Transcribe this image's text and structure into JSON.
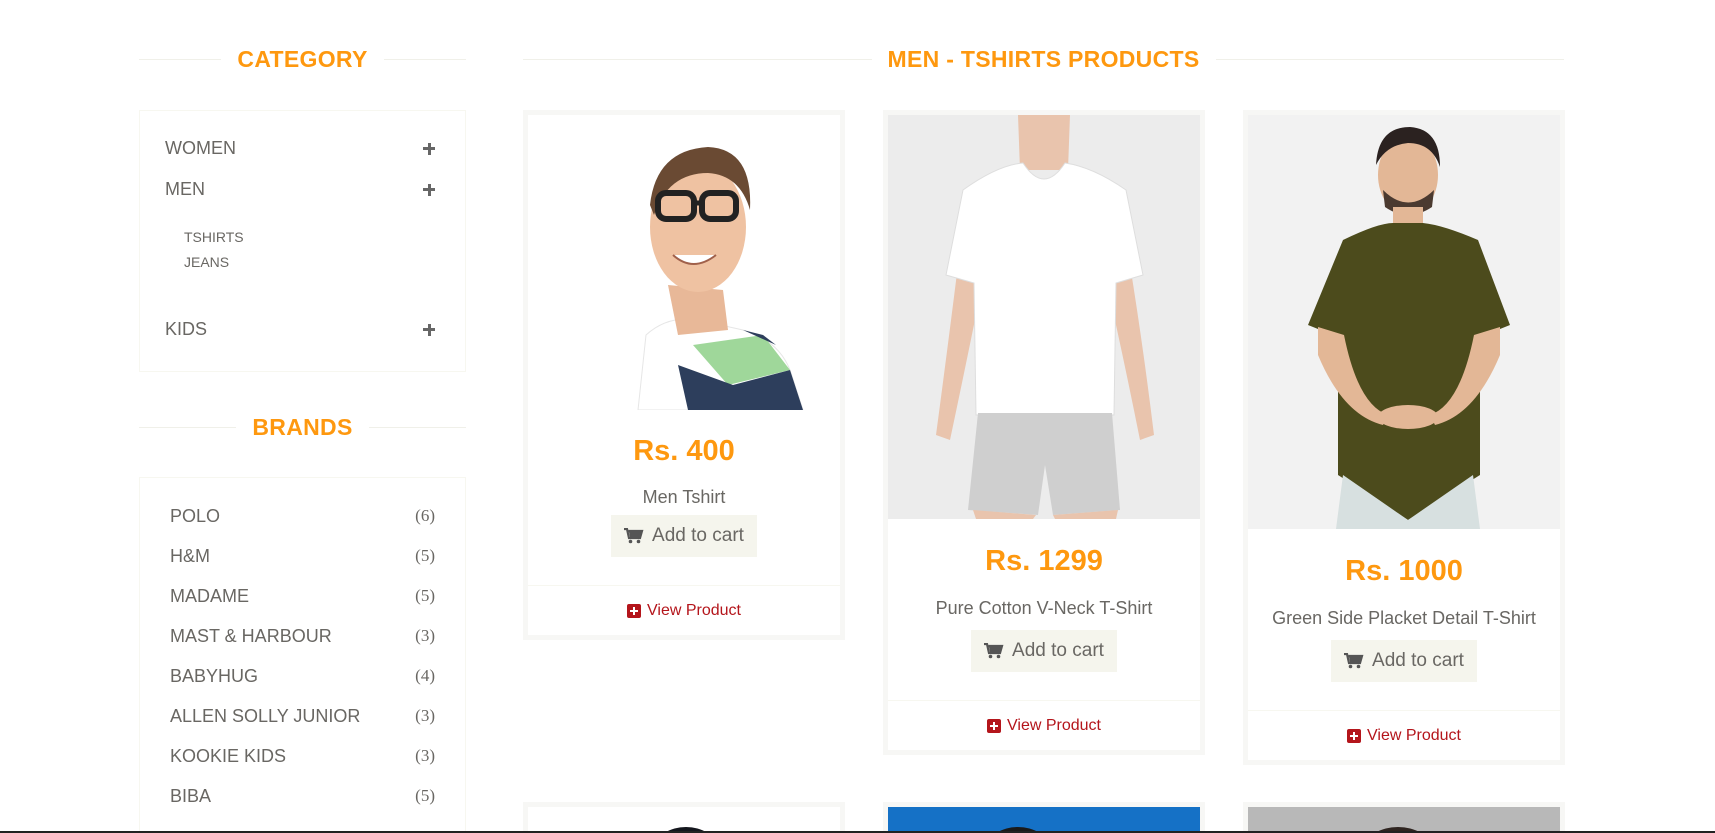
{
  "sidebar": {
    "category_title": "CATEGORY",
    "categories": [
      {
        "label": "WOMEN"
      },
      {
        "label": "MEN",
        "subitems": [
          "TSHIRTS",
          "JEANS"
        ]
      },
      {
        "label": "KIDS"
      }
    ],
    "brands_title": "BRANDS",
    "brands": [
      {
        "name": "POLO",
        "count": "(6)"
      },
      {
        "name": "H&M",
        "count": "(5)"
      },
      {
        "name": "MADAME",
        "count": "(5)"
      },
      {
        "name": "MAST & HARBOUR",
        "count": "(3)"
      },
      {
        "name": "BABYHUG",
        "count": "(4)"
      },
      {
        "name": "ALLEN SOLLY JUNIOR",
        "count": "(3)"
      },
      {
        "name": "KOOKIE KIDS",
        "count": "(3)"
      },
      {
        "name": "BIBA",
        "count": "(5)"
      }
    ]
  },
  "main": {
    "title": "MEN - TSHIRTS PRODUCTS",
    "products": [
      {
        "price": "Rs. 400",
        "name": "Men Tshirt",
        "cart_label": "Add to cart",
        "view_label": "View Product"
      },
      {
        "price": "Rs. 1299",
        "name": "Pure Cotton V-Neck T-Shirt",
        "cart_label": "Add to cart",
        "view_label": "View Product"
      },
      {
        "price": "Rs. 1000",
        "name": "Green Side Placket Detail T-Shirt",
        "cart_label": "Add to cart",
        "view_label": "View Product"
      }
    ]
  },
  "colors": {
    "accent": "#fe980f",
    "link": "#b4151b",
    "text": "#696763",
    "button_bg": "#f5f5ed"
  },
  "icons": {
    "expand": "plus-icon",
    "cart": "shopping-cart-icon",
    "view": "plus-square-icon"
  }
}
